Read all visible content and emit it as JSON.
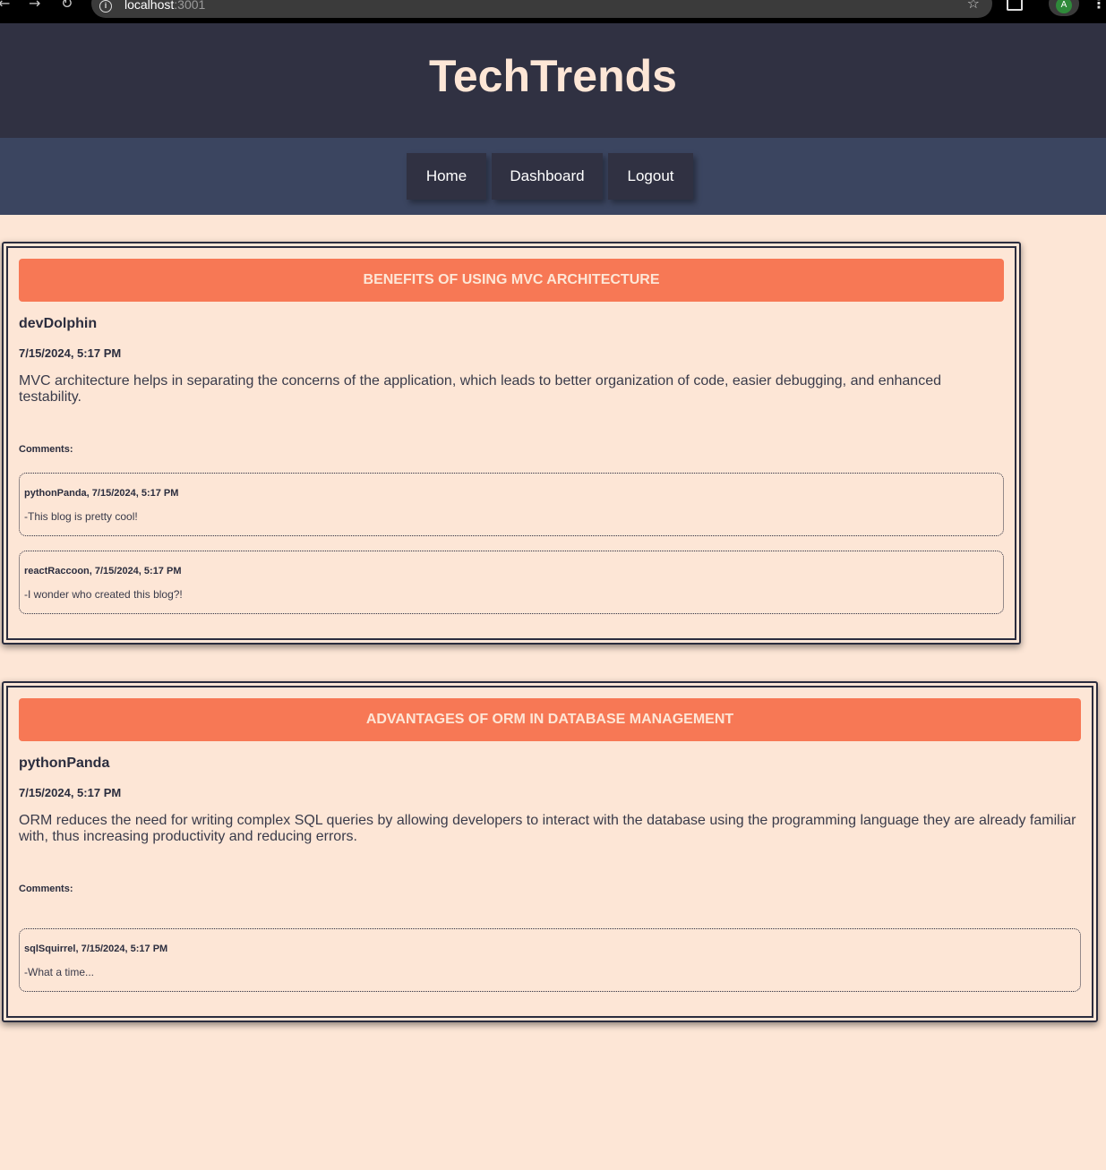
{
  "browser": {
    "url_host": "localhost",
    "url_port": ":3001",
    "profile_initial": "A"
  },
  "site": {
    "title": "TechTrends"
  },
  "nav": {
    "items": [
      {
        "label": "Home"
      },
      {
        "label": "Dashboard"
      },
      {
        "label": "Logout"
      }
    ]
  },
  "posts": [
    {
      "title": "BENEFITS OF USING MVC ARCHITECTURE",
      "author": "devDolphin",
      "date": "7/15/2024, 5:17 PM",
      "body": "MVC architecture helps in separating the concerns of the application, which leads to better organization of code, easier debugging, and enhanced testability.",
      "comments_label": "Comments:",
      "comments": [
        {
          "meta": "pythonPanda, 7/15/2024, 5:17 PM",
          "text": "-This blog is pretty cool!"
        },
        {
          "meta": "reactRaccoon, 7/15/2024, 5:17 PM",
          "text": "-I wonder who created this blog?!"
        }
      ]
    },
    {
      "title": "ADVANTAGES OF ORM IN DATABASE MANAGEMENT",
      "author": "pythonPanda",
      "date": "7/15/2024, 5:17 PM",
      "body": "ORM reduces the need for writing complex SQL queries by allowing developers to interact with the database using the programming language they are already familiar with, thus increasing productivity and reducing errors.",
      "comments_label": "Comments:",
      "comments": [
        {
          "meta": "sqlSquirrel, 7/15/2024, 5:17 PM",
          "text": "-What a time..."
        }
      ]
    }
  ],
  "colors": {
    "page_bg": "#fde6d6",
    "header_bg": "#303142",
    "nav_bg": "#3b4560",
    "accent": "#f77855",
    "text_dark": "#2b2d3e"
  }
}
